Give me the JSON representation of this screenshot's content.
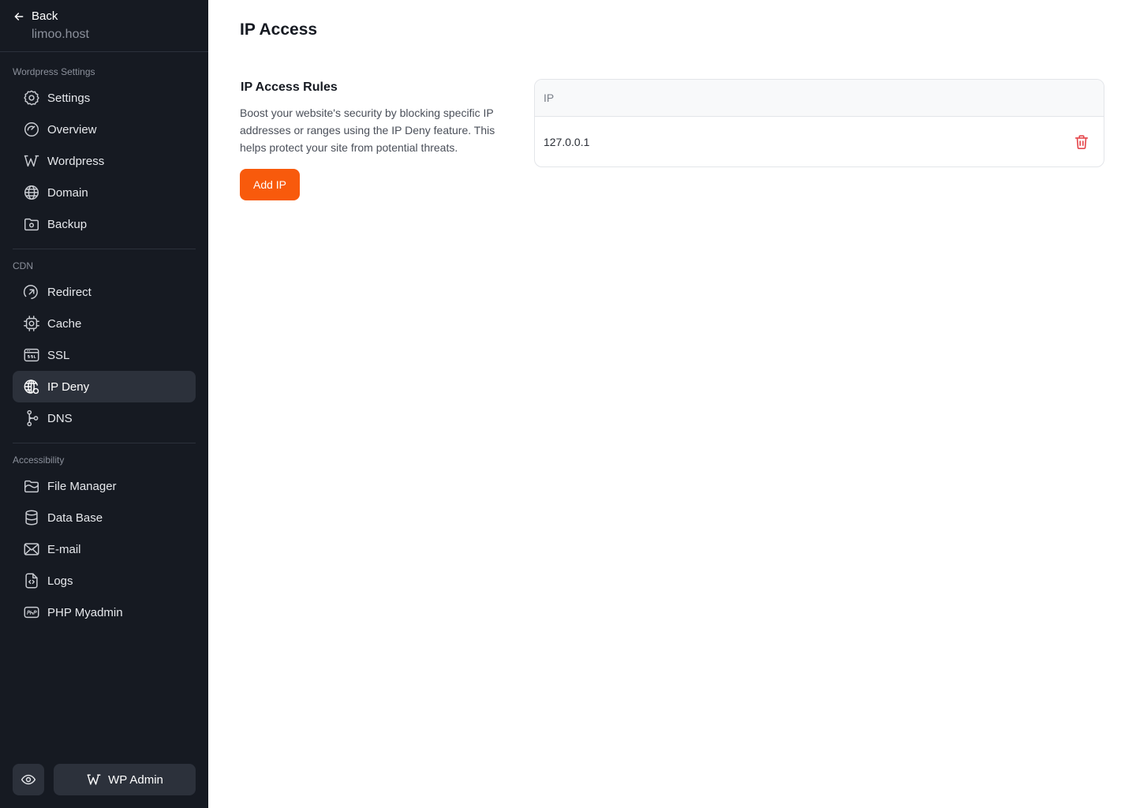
{
  "sidebar": {
    "back_label": "Back",
    "site_name": "limoo.host",
    "sections": [
      {
        "title": "Wordpress Settings"
      },
      {
        "title": "CDN"
      },
      {
        "title": "Accessibility"
      }
    ],
    "items": [
      {
        "label": "Settings",
        "icon": "settings-gear-icon"
      },
      {
        "label": "Overview",
        "icon": "overview-gauge-icon"
      },
      {
        "label": "Wordpress",
        "icon": "wordpress-icon"
      },
      {
        "label": "Domain",
        "icon": "globe-icon"
      },
      {
        "label": "Backup",
        "icon": "backup-folder-icon"
      },
      {
        "label": "Redirect",
        "icon": "redirect-icon"
      },
      {
        "label": "Cache",
        "icon": "cpu-chip-icon"
      },
      {
        "label": "SSL",
        "icon": "ssl-icon"
      },
      {
        "label": "IP Deny",
        "icon": "globe-lock-icon",
        "active": true
      },
      {
        "label": "DNS",
        "icon": "dns-nodes-icon"
      },
      {
        "label": "File Manager",
        "icon": "folder-open-icon"
      },
      {
        "label": "Data Base",
        "icon": "database-icon"
      },
      {
        "label": "E-mail",
        "icon": "mail-icon"
      },
      {
        "label": "Logs",
        "icon": "file-code-icon"
      },
      {
        "label": "PHP Myadmin",
        "icon": "php-icon"
      }
    ],
    "wp_admin_label": "WP Admin"
  },
  "main": {
    "title": "IP Access",
    "rules_title": "IP Access Rules",
    "rules_description": "Boost your website's security by blocking specific IP addresses or ranges using the IP Deny feature. This helps protect your site from potential threats.",
    "add_button": "Add IP",
    "table": {
      "header": "IP",
      "rows": [
        {
          "ip": "127.0.0.1"
        }
      ]
    }
  },
  "colors": {
    "sidebar_bg": "#161a22",
    "active_item_bg": "#2c313b",
    "accent": "#f85a0c",
    "danger": "#e5484d"
  }
}
